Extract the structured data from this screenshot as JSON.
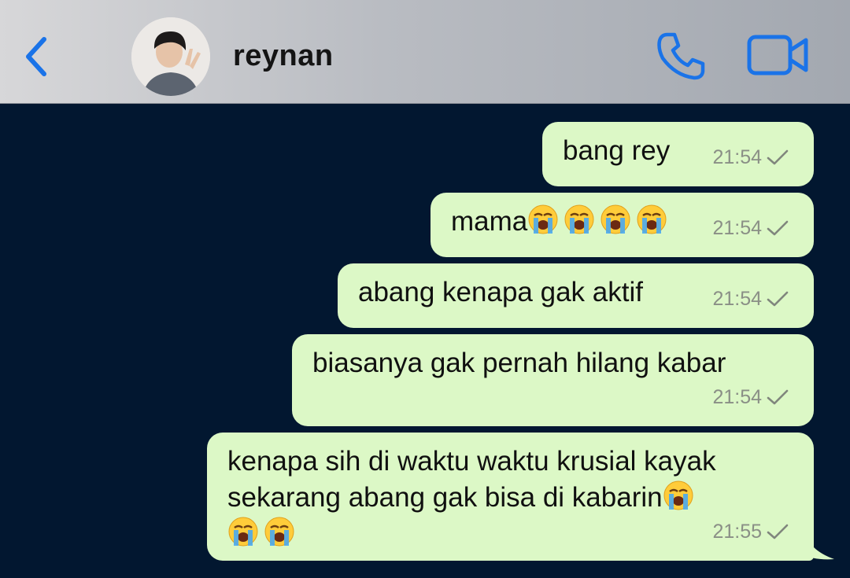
{
  "header": {
    "contact_name": "reynan",
    "back_icon": "chevron-left-icon",
    "call_icon": "phone-icon",
    "video_icon": "video-camera-icon"
  },
  "colors": {
    "accent": "#1a73e8",
    "bubble": "#dcf8c6",
    "chat_background": "#021730"
  },
  "messages": [
    {
      "text": "bang rey",
      "time": "21:54",
      "status": "sent-check"
    },
    {
      "text": "mama",
      "emoji_after": "loudly-crying-face x4",
      "time": "21:54",
      "status": "sent-check"
    },
    {
      "text": "abang kenapa gak aktif",
      "time": "21:54",
      "status": "sent-check"
    },
    {
      "text": "biasanya gak pernah hilang kabar",
      "time": "21:54",
      "status": "sent-check"
    },
    {
      "text_line1": "kenapa sih di waktu waktu krusial kayak",
      "text_line2": "sekarang abang gak bisa di kabarin",
      "emoji_after": "loudly-crying-face x3",
      "time": "21:55",
      "status": "sent-check"
    }
  ]
}
